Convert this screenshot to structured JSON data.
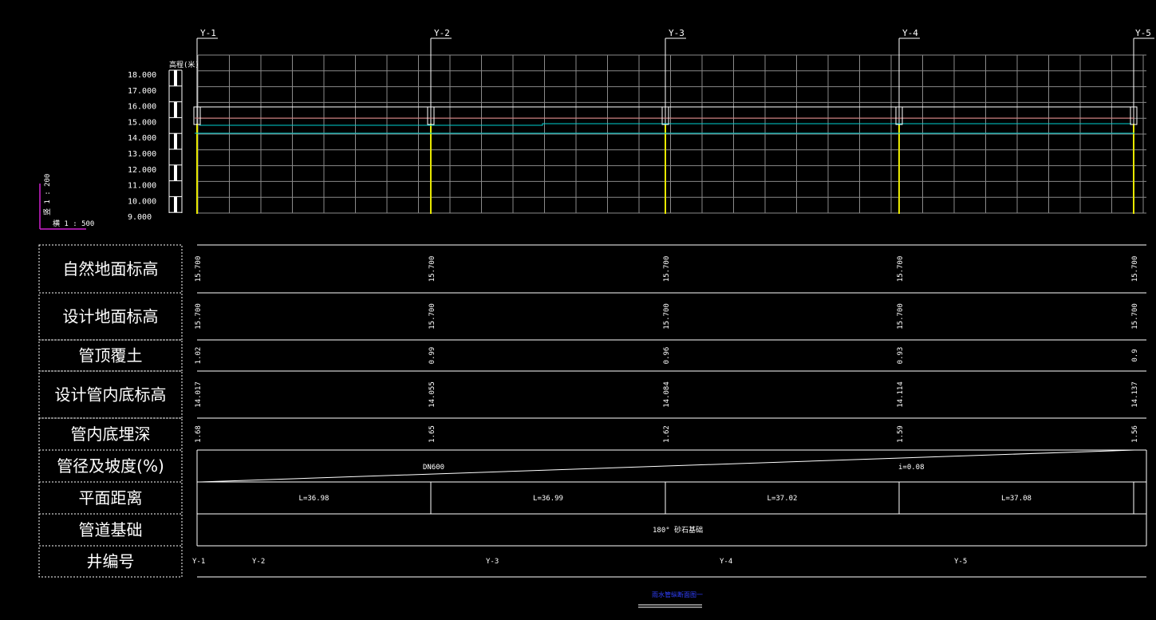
{
  "manholes": [
    {
      "id": "Y-1",
      "ground_natural": "15.700",
      "ground_design": "15.700",
      "cover": "1.02",
      "invert": "14.017",
      "depth": "1.68"
    },
    {
      "id": "Y-2",
      "ground_natural": "15.700",
      "ground_design": "15.700",
      "cover": "0.99",
      "invert": "14.055",
      "depth": "1.65"
    },
    {
      "id": "Y-3",
      "ground_natural": "15.700",
      "ground_design": "15.700",
      "cover": "0.96",
      "invert": "14.084",
      "depth": "1.62"
    },
    {
      "id": "Y-4",
      "ground_natural": "15.700",
      "ground_design": "15.700",
      "cover": "0.93",
      "invert": "14.114",
      "depth": "1.59"
    },
    {
      "id": "Y-5",
      "ground_natural": "15.700",
      "ground_design": "15.700",
      "cover": "0.9",
      "invert": "14.137",
      "depth": "1.56"
    }
  ],
  "elevation_axis": {
    "label": "高程(米)",
    "ticks": [
      "18.000",
      "17.000",
      "16.000",
      "15.000",
      "14.000",
      "13.000",
      "12.000",
      "11.000",
      "10.000",
      "9.000"
    ]
  },
  "scale": {
    "vertical": "竖 1 : 200",
    "horizontal": "横 1 : 500"
  },
  "rows": {
    "ground_natural": "自然地面标高",
    "ground_design": "设计地面标高",
    "cover": "管顶覆土",
    "invert": "设计管内底标高",
    "depth": "管内底埋深",
    "pipe": "管径及坡度(%)",
    "distance": "平面距离",
    "foundation": "管道基础",
    "well": "井编号"
  },
  "pipe": {
    "diameter": "DN600",
    "slope": "i=0.08"
  },
  "distances": [
    "L=36.98",
    "L=36.99",
    "L=37.02",
    "L=37.08"
  ],
  "foundation_text": "180° 砂石基础",
  "well_row_labels": [
    "Y-1",
    "Y-2",
    "Y-3",
    "Y-4",
    "Y-5"
  ],
  "drawing_title": "雨水管纵断面图一",
  "colors": {
    "grid": "#8a8a8a",
    "white": "#ffffff",
    "yellow": "#e8e800",
    "cyan": "#00d0d0",
    "magenta": "#d020d0",
    "pink": "#e08080",
    "blue": "#3040ff"
  }
}
